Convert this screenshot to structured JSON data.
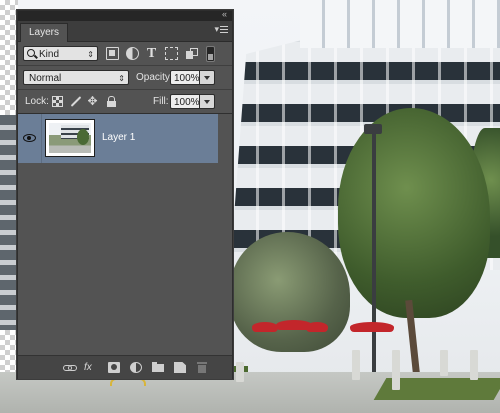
{
  "panel": {
    "tab_label": "Layers",
    "collapse_glyph": "«",
    "menu_glyph": "▾",
    "icons": [
      "collapse-icon",
      "panel-menu-icon"
    ]
  },
  "filter": {
    "kind_label": "Kind",
    "icons": [
      "pixel-layer-filter-icon",
      "adjustment-layer-filter-icon",
      "type-layer-filter-icon",
      "shape-layer-filter-icon",
      "smart-object-filter-icon",
      "filter-toggle-icon"
    ],
    "type_glyph": "T"
  },
  "blending": {
    "mode": "Normal",
    "opacity_label": "Opacity:",
    "opacity_value": "100%"
  },
  "lock": {
    "label": "Lock:",
    "icons": [
      "lock-transparent-pixels-icon",
      "lock-image-pixels-icon",
      "lock-position-icon",
      "lock-all-icon"
    ],
    "move_glyph": "✥",
    "fill_label": "Fill:",
    "fill_value": "100%"
  },
  "layers": [
    {
      "name": "Layer 1",
      "visible": true,
      "selected": true,
      "selected_color": "#6b7e97"
    }
  ],
  "bottom_toolbar": {
    "fx_label": "fx",
    "icons": [
      "link-layers-icon",
      "layer-style-icon",
      "add-mask-icon",
      "new-adjustment-layer-icon",
      "new-group-icon",
      "new-layer-icon",
      "delete-layer-icon"
    ]
  },
  "colors": {
    "panel_bg": "#535353",
    "tab_bar_bg": "#3d3d3d",
    "selection": "#6b7e97"
  }
}
